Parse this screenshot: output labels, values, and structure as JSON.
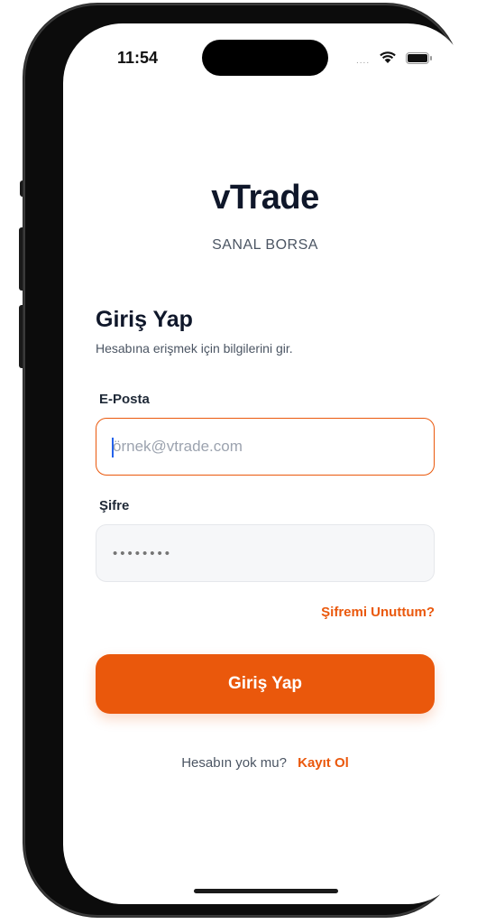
{
  "status_bar": {
    "time": "11:54",
    "signal": "....",
    "wifi_icon": "wifi-icon",
    "battery_icon": "battery-icon"
  },
  "brand": {
    "name": "vTrade",
    "tagline": "SANAL BORSA"
  },
  "login": {
    "heading": "Giriş Yap",
    "subtext": "Hesabına erişmek için bilgilerini gir.",
    "email": {
      "label": "E-Posta",
      "placeholder": "örnek@vtrade.com",
      "value": ""
    },
    "password": {
      "label": "Şifre",
      "placeholder": "••••••••",
      "value": ""
    },
    "forgot_password": "Şifremi Unuttum?",
    "submit_label": "Giriş Yap",
    "register_prompt": "Hesabın yok mu?",
    "register_link": "Kayıt Ol"
  },
  "colors": {
    "accent": "#ea580c",
    "heading": "#0f172a",
    "muted": "#4b5563"
  }
}
